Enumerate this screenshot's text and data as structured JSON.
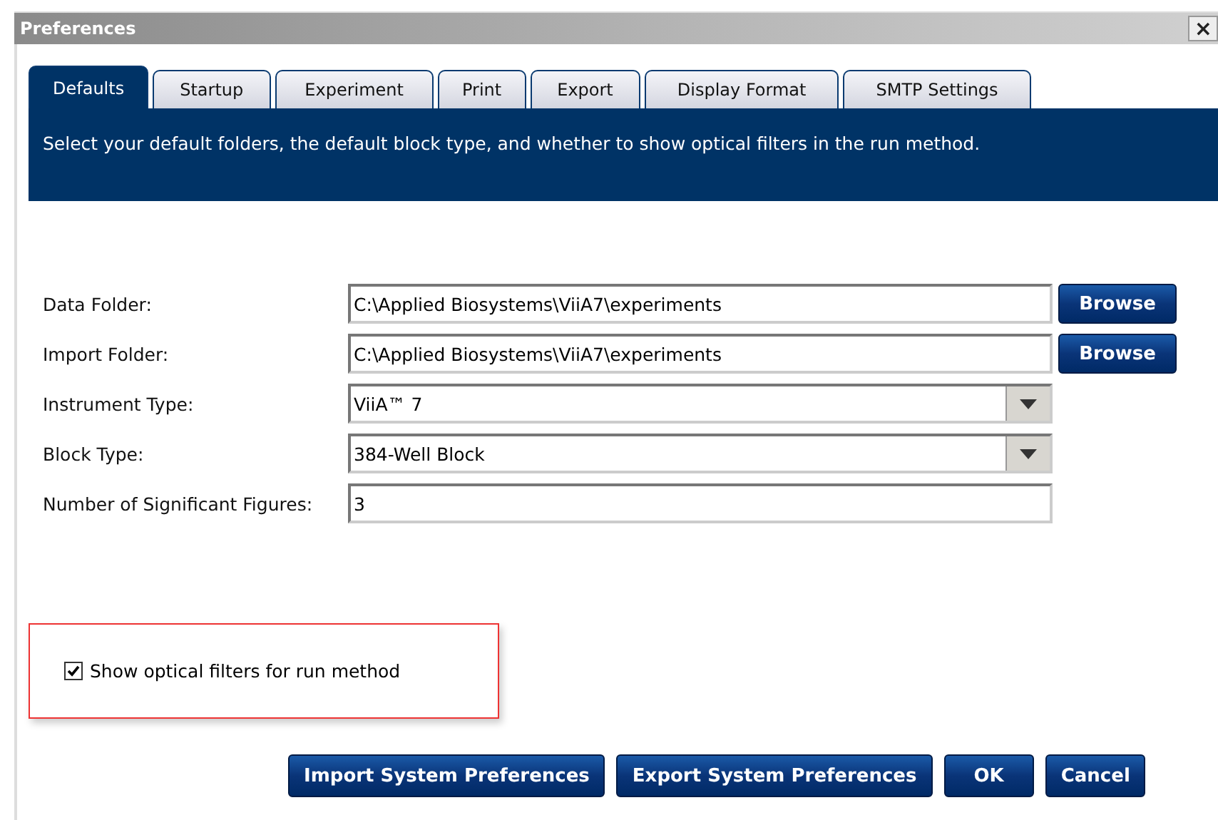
{
  "window": {
    "title": "Preferences",
    "close": "×"
  },
  "tabs": [
    {
      "label": "Defaults",
      "selected": true
    },
    {
      "label": "Startup",
      "selected": false
    },
    {
      "label": "Experiment",
      "selected": false
    },
    {
      "label": "Print",
      "selected": false
    },
    {
      "label": "Export",
      "selected": false
    },
    {
      "label": "Display Format",
      "selected": false
    },
    {
      "label": "SMTP Settings",
      "selected": false
    }
  ],
  "description": "Select your default folders, the default block type, and whether to show optical filters in the run method.",
  "fields": [
    {
      "kind": "text",
      "label": "Data Folder:",
      "value": "C:\\Applied Biosystems\\ViiA7\\experiments",
      "button": "Browse"
    },
    {
      "kind": "text",
      "label": "Import Folder:",
      "value": "C:\\Applied Biosystems\\ViiA7\\experiments",
      "button": "Browse"
    },
    {
      "kind": "dropdown",
      "label": "Instrument Type:",
      "value": "ViiA™ 7"
    },
    {
      "kind": "dropdown",
      "label": "Block Type:",
      "value": "384-Well Block"
    },
    {
      "kind": "text",
      "label": "Number of Significant Figures:",
      "value": "3"
    }
  ],
  "option": {
    "label": "Show optical filters for run method",
    "checked": true
  },
  "buttons": [
    "Import System Preferences",
    "Export System Preferences",
    "OK",
    "Cancel"
  ]
}
